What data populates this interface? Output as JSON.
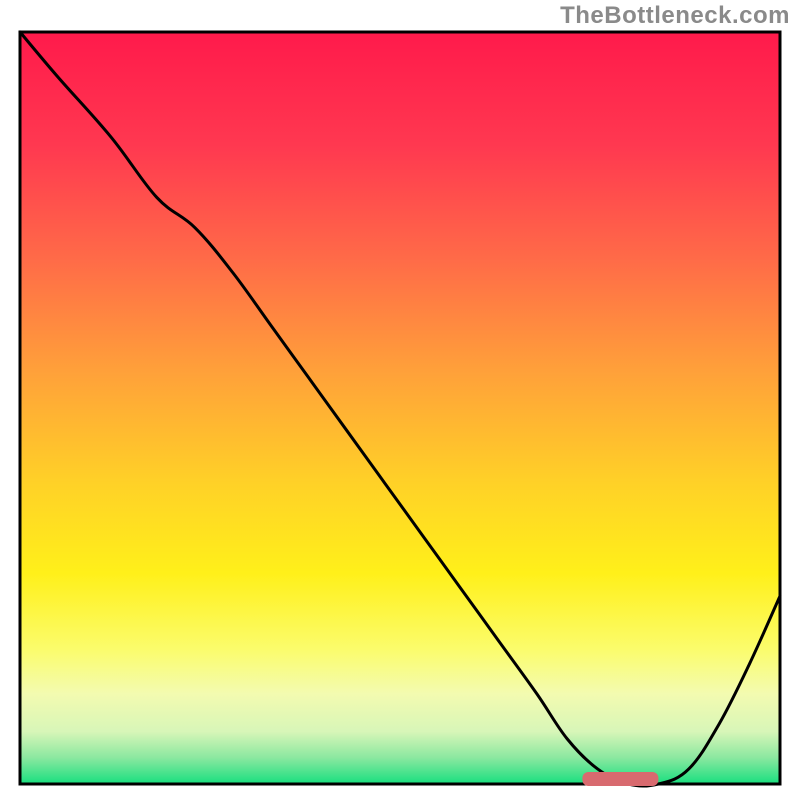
{
  "watermark_text": "TheBottleneck.com",
  "chart_data": {
    "type": "line",
    "title": "",
    "xlabel": "",
    "ylabel": "",
    "xlim": [
      0,
      100
    ],
    "ylim": [
      0,
      100
    ],
    "x": [
      0,
      5,
      12,
      18,
      23,
      28,
      33,
      38,
      43,
      48,
      53,
      58,
      63,
      68,
      72,
      76,
      80,
      84,
      88,
      92,
      96,
      100
    ],
    "values": [
      100,
      94,
      86,
      78,
      74,
      68,
      61,
      54,
      47,
      40,
      33,
      26,
      19,
      12,
      6,
      2,
      0,
      0,
      2,
      8,
      16,
      25
    ],
    "marker": {
      "x_start": 74,
      "x_end": 84,
      "y": 0,
      "color": "#d86a6f"
    },
    "gradient_stops": [
      {
        "offset": 0.0,
        "color": "#ff1a4b"
      },
      {
        "offset": 0.15,
        "color": "#ff3850"
      },
      {
        "offset": 0.3,
        "color": "#ff6a48"
      },
      {
        "offset": 0.45,
        "color": "#ffa03a"
      },
      {
        "offset": 0.6,
        "color": "#ffd127"
      },
      {
        "offset": 0.72,
        "color": "#fff01a"
      },
      {
        "offset": 0.82,
        "color": "#fbfc6b"
      },
      {
        "offset": 0.88,
        "color": "#f3fbb0"
      },
      {
        "offset": 0.93,
        "color": "#d8f6b8"
      },
      {
        "offset": 0.965,
        "color": "#8be8a0"
      },
      {
        "offset": 1.0,
        "color": "#18df7f"
      }
    ],
    "border_color": "#000000",
    "curve_color": "#000000",
    "curve_width": 3
  }
}
